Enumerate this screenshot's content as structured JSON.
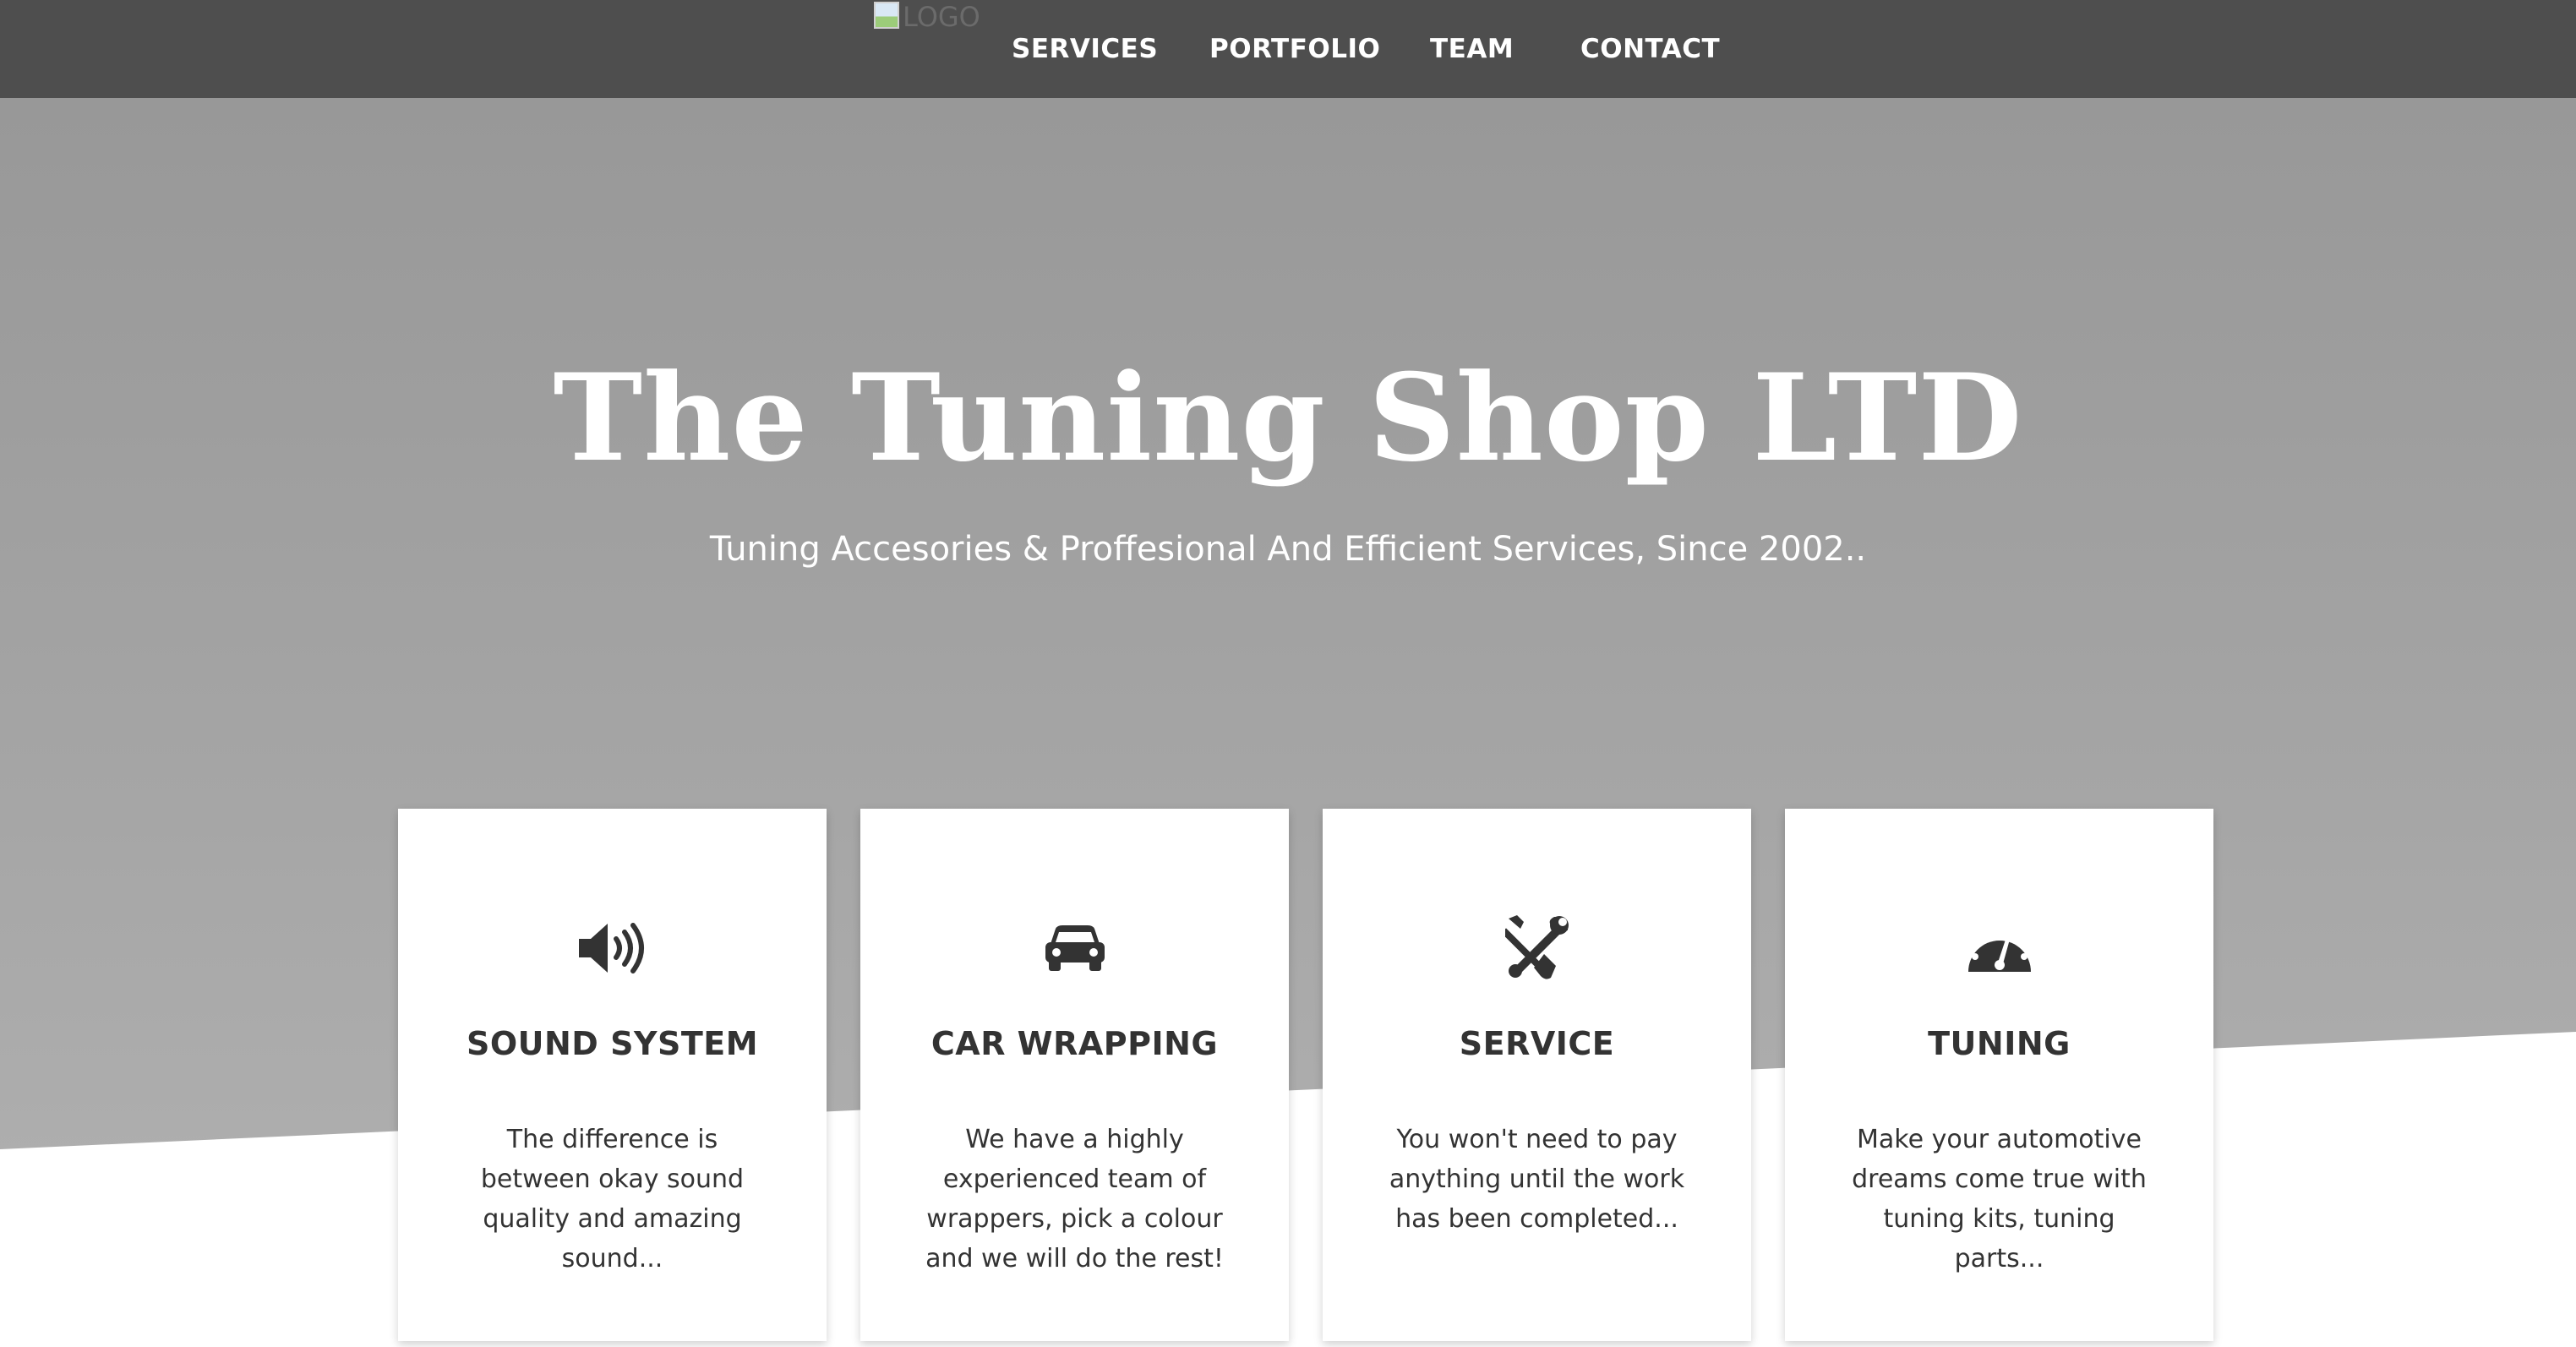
{
  "navbar": {
    "logo_alt": "LOGO",
    "items": [
      {
        "label": "SERVICES"
      },
      {
        "label": "PORTFOLIO"
      },
      {
        "label": "TEAM"
      },
      {
        "label": "CONTACT"
      }
    ]
  },
  "hero": {
    "title": "The Tuning Shop LTD",
    "subtitle": "Tuning Accesories & Proffesional And Efficient Services, Since 2002.."
  },
  "cards": [
    {
      "icon": "volume-icon",
      "title": "SOUND SYSTEM",
      "text": "The difference is between okay sound quality and amazing sound..."
    },
    {
      "icon": "car-icon",
      "title": "CAR WRAPPING",
      "text": "We have a highly experienced team of wrappers, pick a colour and we will do the rest!"
    },
    {
      "icon": "tools-icon",
      "title": "SERVICE",
      "text": "You won't need to pay anything until the work has been completed..."
    },
    {
      "icon": "speedometer-icon",
      "title": "TUNING",
      "text": "Make your automotive dreams come true with tuning kits, tuning parts..."
    }
  ],
  "colors": {
    "navbar_bg": "#4e4e4e",
    "hero_bg": "#a4a4a4",
    "card_bg": "#ffffff",
    "text_dark": "#333333",
    "icon_color": "#333333"
  }
}
